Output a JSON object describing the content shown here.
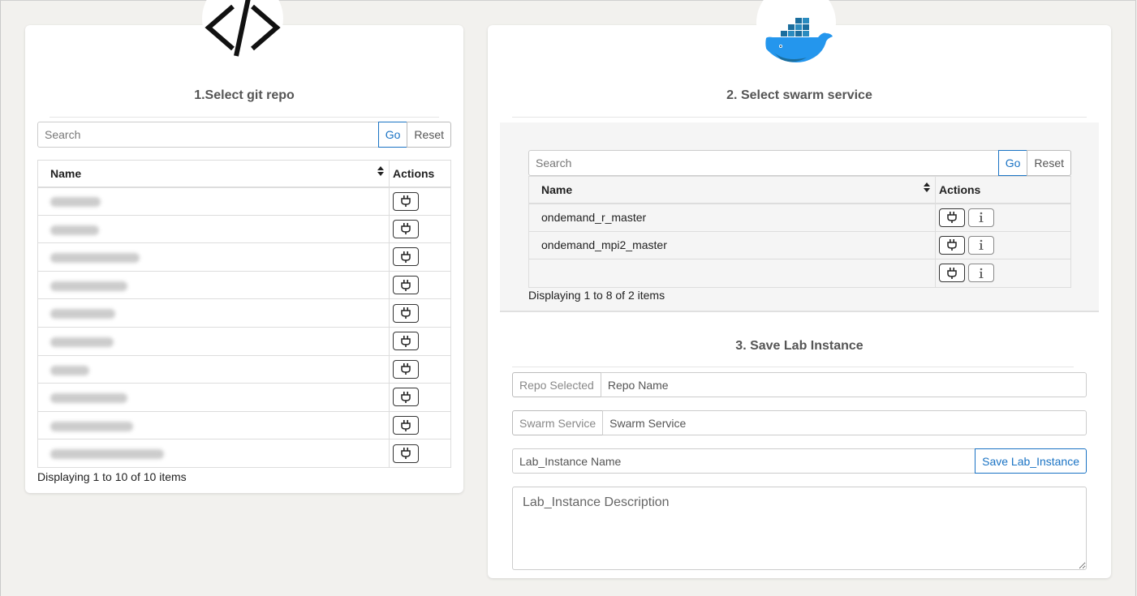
{
  "left_panel": {
    "title": "1.Select git repo",
    "badge_icon": "code-icon",
    "search": {
      "placeholder": "Search",
      "go_label": "Go",
      "reset_label": "Reset"
    },
    "table": {
      "columns": [
        "Name",
        "Actions"
      ],
      "row_count": 10,
      "row_icon": "plug-icon"
    },
    "footer": "Displaying 1 to 10 of 10 items"
  },
  "right_panel": {
    "badge_icon": "docker-whale-icon",
    "swarm": {
      "title": "2. Select swarm service",
      "search": {
        "placeholder": "Search",
        "go_label": "Go",
        "reset_label": "Reset"
      },
      "table": {
        "columns": [
          "Name",
          "Actions"
        ],
        "rows": [
          "ondemand_r_master",
          "ondemand_mpi2_master",
          ""
        ]
      },
      "footer": "Displaying 1 to 8 of 2 items"
    },
    "save": {
      "title": "3. Save Lab Instance",
      "repo_selected_label": "Repo Selected",
      "repo_name_placeholder": "Repo Name",
      "swarm_service_label": "Swarm Service",
      "swarm_service_placeholder": "Swarm Service",
      "lab_instance_name_placeholder": "Lab_Instance Name",
      "save_button_label": "Save Lab_Instance",
      "description_placeholder": "Lab_Instance Description"
    }
  },
  "colors": {
    "accent": "#1a73c4",
    "background": "#f2f1ee",
    "docker_blue": "#2496ed"
  }
}
